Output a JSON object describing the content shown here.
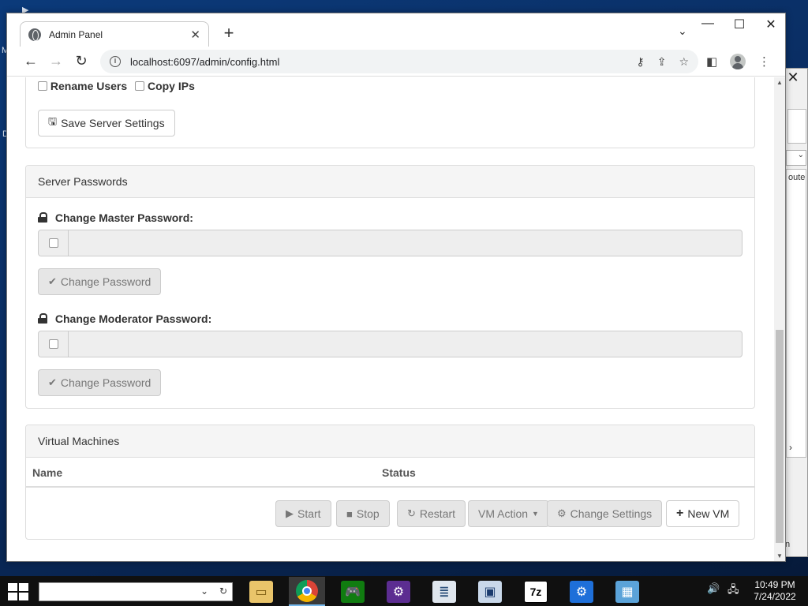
{
  "browser": {
    "tab_title": "Admin Panel",
    "url": "localhost:6097/admin/config.html"
  },
  "server_settings": {
    "rename_users_label": "Rename Users",
    "copy_ips_label": "Copy IPs",
    "save_button": "Save Server Settings"
  },
  "server_passwords": {
    "heading": "Server Passwords",
    "master_label": "Change Master Password:",
    "master_button": "Change Password",
    "moderator_label": "Change Moderator Password:",
    "moderator_button": "Change Password"
  },
  "virtual_machines": {
    "heading": "Virtual Machines",
    "columns": [
      "Name",
      "Status"
    ],
    "buttons": {
      "start": "Start",
      "stop": "Stop",
      "restart": "Restart",
      "vm_action": "VM Action",
      "change_settings": "Change Settings",
      "new_vm": "New VM"
    }
  },
  "background_window": {
    "column_fragment": "oute",
    "footer_fragment": "n"
  },
  "desktop": {
    "glyphs": [
      "M",
      "D"
    ]
  },
  "taskbar": {
    "time": "10:49 PM",
    "date": "7/24/2022",
    "apps": [
      "file-explorer",
      "chrome",
      "xbox-game",
      "settings-gear",
      "notepad-doc",
      "monitor",
      "7zip",
      "settings-blue",
      "control-panel"
    ]
  },
  "colors": {
    "panel_heading_bg": "#f5f5f5",
    "disabled_button_bg": "#e6e6e6",
    "taskbar_bg": "#101010",
    "desktop_bg": "#0a2a5c"
  }
}
